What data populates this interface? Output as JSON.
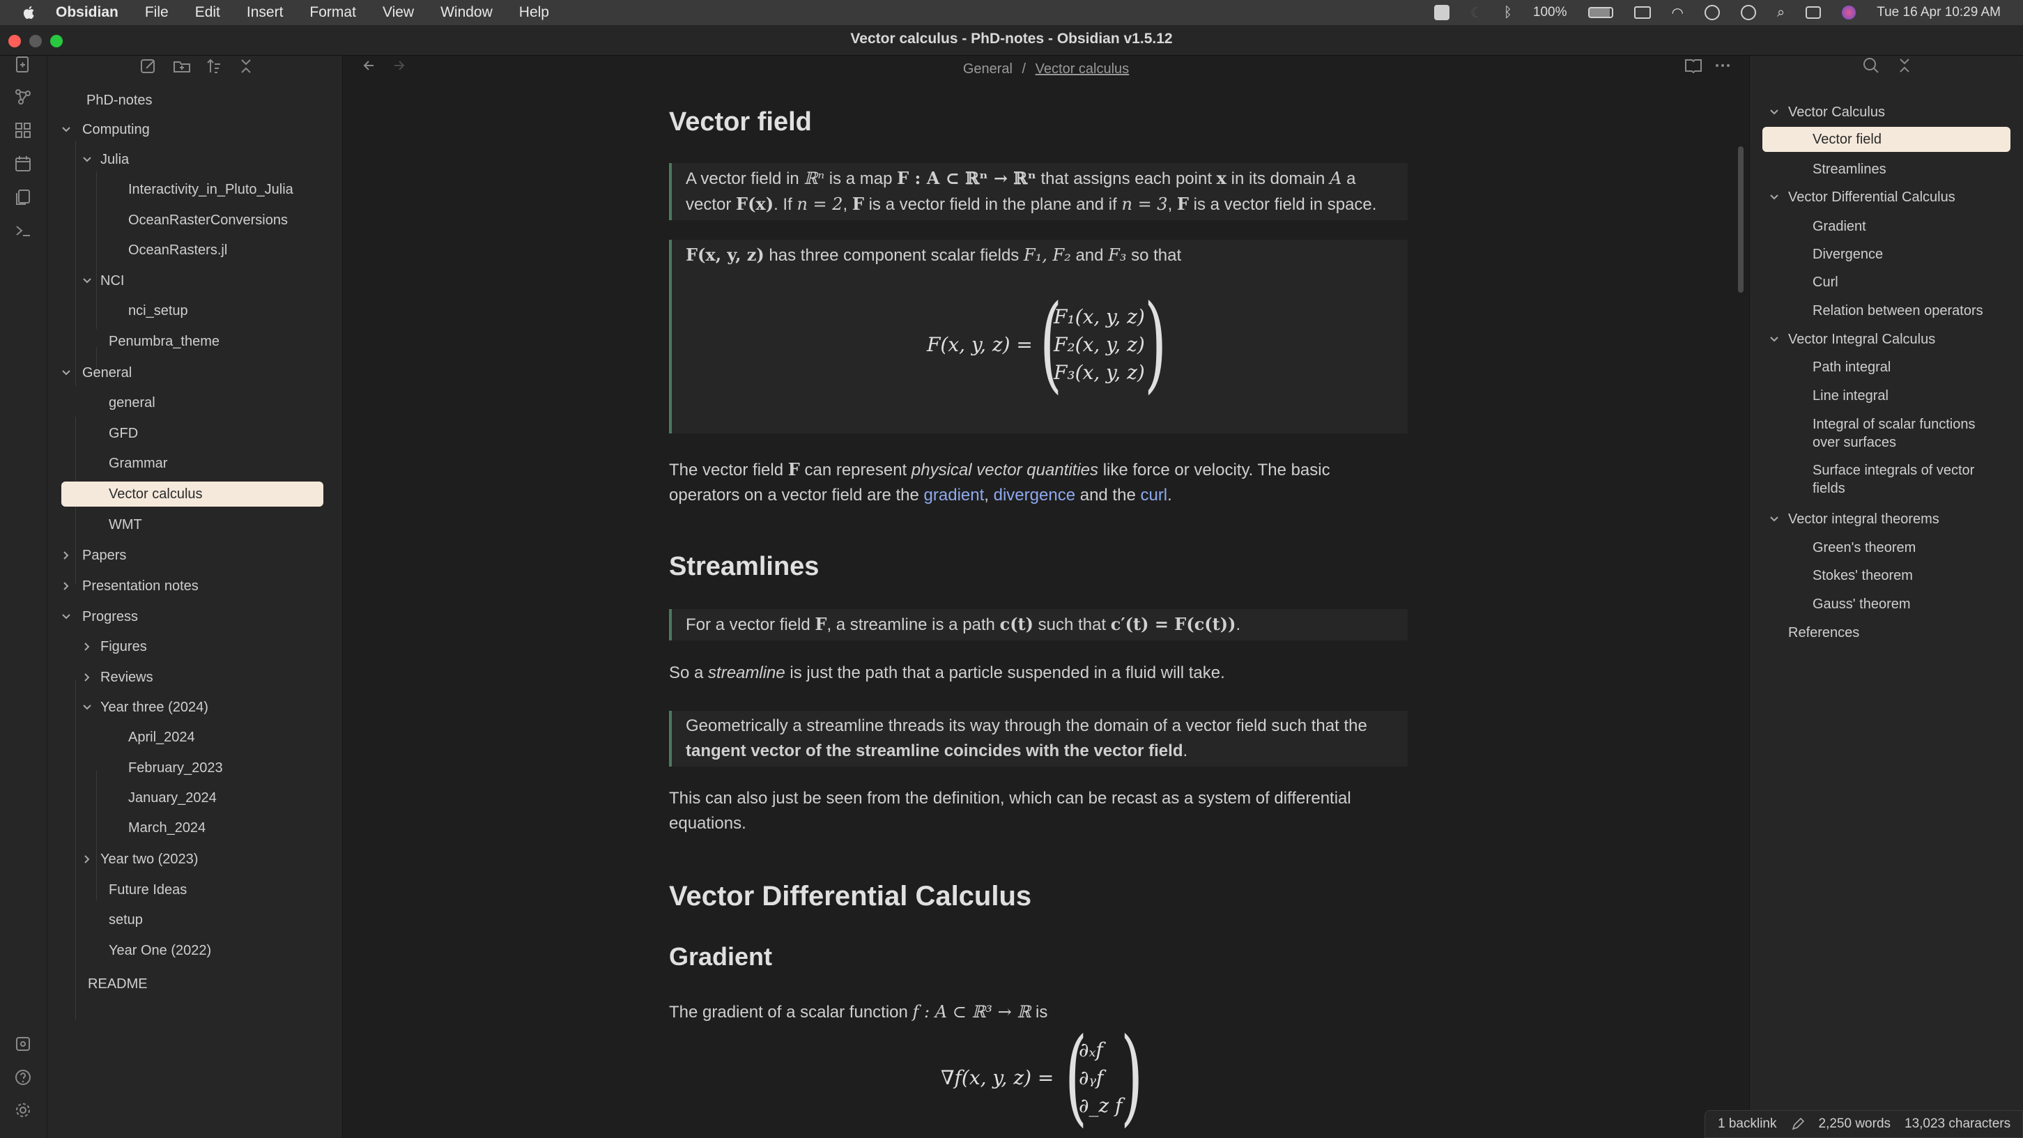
{
  "menubar": {
    "app_name": "Obsidian",
    "items": [
      "File",
      "Edit",
      "Insert",
      "Format",
      "View",
      "Window",
      "Help"
    ],
    "battery": "100%",
    "datetime": "Tue 16 Apr  10:29 AM"
  },
  "window": {
    "title": "Vector calculus - PhD-notes - Obsidian v1.5.12"
  },
  "breadcrumb": {
    "folder": "General",
    "separator": "/",
    "note": "Vector calculus"
  },
  "explorer": {
    "vault": "PhD-notes",
    "items": [
      "Computing",
      "Julia",
      "Interactivity_in_Pluto_Julia",
      "OceanRasterConversions",
      "OceanRasters.jl",
      "NCI",
      "nci_setup",
      "Penumbra_theme",
      "General",
      "general",
      "GFD",
      "Grammar",
      "Vector calculus",
      "WMT",
      "Papers",
      "Presentation notes",
      "Progress",
      "Figures",
      "Reviews",
      "Year three (2024)",
      "April_2024",
      "February_2023",
      "January_2024",
      "March_2024",
      "Year two (2023)",
      "Future Ideas",
      "setup",
      "Year One (2022)",
      "README"
    ]
  },
  "doc": {
    "h_vector_field": "Vector field",
    "callout1_a": "A vector field in ",
    "callout1_b": " is a map ",
    "callout1_c": " that assigns each point ",
    "callout1_d": " in its domain ",
    "callout1_e": " a",
    "callout1_f": "vector ",
    "callout1_g": ". If ",
    "callout1_h": ", ",
    "callout1_i": " is a vector field in the plane and if ",
    "callout1_j": ", ",
    "callout1_k": " is a vector field in space.",
    "m_Rn": "ℝⁿ",
    "m_map": "F : A ⊂ ℝⁿ → ℝⁿ",
    "m_x": "x",
    "m_A": "A",
    "m_Fx": "F(x)",
    "m_n2": "n = 2",
    "m_F": "F",
    "m_n3": "n = 3",
    "callout2_a": " has three component scalar fields ",
    "callout2_b": " and ",
    "callout2_c": " so that",
    "m_Fxyz": "F(x, y, z)",
    "m_F1F2": "F₁, F₂",
    "m_F3": "F₃",
    "eq1_lhs": "F(x, y, z) =",
    "eq1_r1": "F₁(x, y, z)",
    "eq1_r2": "F₂(x, y, z)",
    "eq1_r3": "F₃(x, y, z)",
    "eq1_end": ".",
    "p1_a": "The vector field ",
    "p1_b": " can represent ",
    "p1_em": "physical vector quantities",
    "p1_c": " like force or velocity. The basic",
    "p1_d": "operators on a vector field are the ",
    "p1_gradient": "gradient",
    "p1_comma": ", ",
    "p1_divergence": "divergence",
    "p1_and": " and the ",
    "p1_curl": "curl",
    "p1_end": ".",
    "h_streamlines": "Streamlines",
    "callout3_a": "For a vector field ",
    "callout3_b": ", a streamline is a path ",
    "callout3_c": " such that ",
    "callout3_d": ".",
    "m_ct": "c(t)",
    "m_cdef": "c′(t) = F(c(t))",
    "p2_a": "So a ",
    "p2_em": "streamline",
    "p2_b": " is just the path that a particle suspended in a fluid will take.",
    "callout4_a": "Geometrically a streamline threads its way through the domain of a vector field such that the",
    "callout4_b": "tangent vector of the streamline coincides with the vector field",
    "callout4_c": ".",
    "p3_a": "This can also just be seen from the definition, which can be recast as a system of differential",
    "p3_b": "equations.",
    "h_vdc": "Vector Differential Calculus",
    "h_gradient": "Gradient",
    "p4_a": "The gradient of a scalar function ",
    "p4_b": " is",
    "m_fmap": "f : A ⊂ ℝ³ → ℝ",
    "eq2_lhs": "∇f(x, y, z) =",
    "eq2_r1": "∂ₓf",
    "eq2_r2": "∂ᵧf",
    "eq2_r3": "∂_z f",
    "eq2_end": "."
  },
  "outline": {
    "items": [
      "Vector Calculus",
      "Vector field",
      "Streamlines",
      "Vector Differential Calculus",
      "Gradient",
      "Divergence",
      "Curl",
      "Relation between operators",
      "Vector Integral Calculus",
      "Path integral",
      "Line integral",
      "Integral of scalar functions over surfaces",
      "Surface integrals of vector fields",
      "Vector integral theorems",
      "Green's theorem",
      "Stokes' theorem",
      "Gauss' theorem",
      "References"
    ]
  },
  "status": {
    "backlinks": "1 backlink",
    "words": "2,250 words",
    "characters": "13,023 characters"
  }
}
